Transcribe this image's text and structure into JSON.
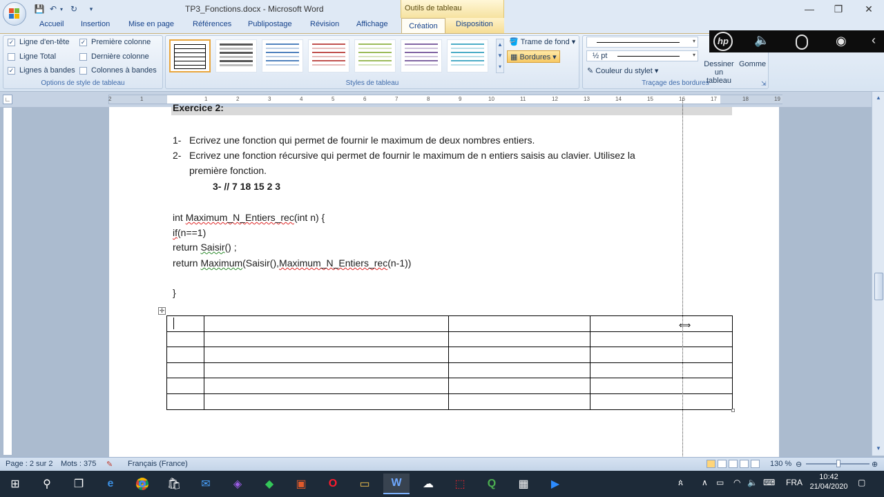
{
  "window": {
    "title": "TP3_Fonctions.docx - Microsoft Word",
    "context_tab_title": "Outils de tableau",
    "minimize": "—",
    "maximize": "❐",
    "close": "✕"
  },
  "qat": {
    "save": "💾",
    "undo": "↶",
    "undo_arrow": "▾",
    "redo": "↻",
    "more": "▾"
  },
  "tabs": [
    "Accueil",
    "Insertion",
    "Mise en page",
    "Références",
    "Publipostage",
    "Révision",
    "Affichage",
    "Création",
    "Disposition"
  ],
  "ribbon": {
    "options_group": {
      "label": "Options de style de tableau",
      "items": [
        {
          "label": "Ligne d'en-tête",
          "checked": true
        },
        {
          "label": "Première colonne",
          "checked": true
        },
        {
          "label": "Ligne Total",
          "checked": false
        },
        {
          "label": "Dernière colonne",
          "checked": false
        },
        {
          "label": "Lignes à bandes",
          "checked": true
        },
        {
          "label": "Colonnes à bandes",
          "checked": false
        }
      ]
    },
    "styles_group": {
      "label": "Styles de tableau",
      "trame": "Trame de fond",
      "bordures": "Bordures"
    },
    "borders_group": {
      "label": "Traçage des bordures",
      "weight": "½ pt",
      "pen_color": "Couleur du stylet",
      "draw_table_1": "Dessiner",
      "draw_table_2": "un tableau",
      "eraser": "Gomme"
    }
  },
  "ruler": {
    "labels": [
      "2",
      "1",
      "1",
      "2",
      "3",
      "4",
      "5",
      "6",
      "7",
      "8",
      "9",
      "10",
      "11",
      "12",
      "13",
      "14",
      "15",
      "16",
      "17",
      "18",
      "19"
    ]
  },
  "document": {
    "heading": "Exercice 2:",
    "item1_num": "1-",
    "item1": "Ecrivez  une fonction qui permet de fournir le maximum de deux nombres entiers.",
    "item2_num": "2-",
    "item2_line1": "Ecrivez une fonction récursive qui permet de fournir le maximum de n entiers saisis au clavier. Utilisez la",
    "item2_line2": "première fonction.",
    "item3": "3-   // 7 18  15  2  3",
    "code": {
      "l1_pre": " int ",
      "l1_fn": "Maximum_N_Entiers_rec",
      "l1_post": "(int  n) {",
      "l2_if": "if",
      "l2_rest": "(n==1)",
      "l3_pre": "return ",
      "l3_fn": "Saisir",
      "l3_post": "() ;",
      "l4_pre": "return ",
      "l4_fn1": "Maximum",
      "l4_mid": "(Saisir(),",
      "l4_fn2": "Maximum_N_Entiers_rec",
      "l4_post": "(n-1))",
      "l5": "}"
    },
    "table": {
      "rows": 6,
      "cols": 4
    }
  },
  "status": {
    "page": "Page : 2 sur 2",
    "words": "Mots : 375",
    "language": "Français (France)",
    "zoom": "130 %"
  },
  "taskbar": {
    "lang": "FRA",
    "time": "10:42",
    "date": "21/04/2020"
  },
  "colors": {
    "ribbon_bg": "#dfe9f5",
    "accent": "#15428b",
    "context_tab": "#f6e2a0",
    "taskbar": "#1d2a38"
  }
}
